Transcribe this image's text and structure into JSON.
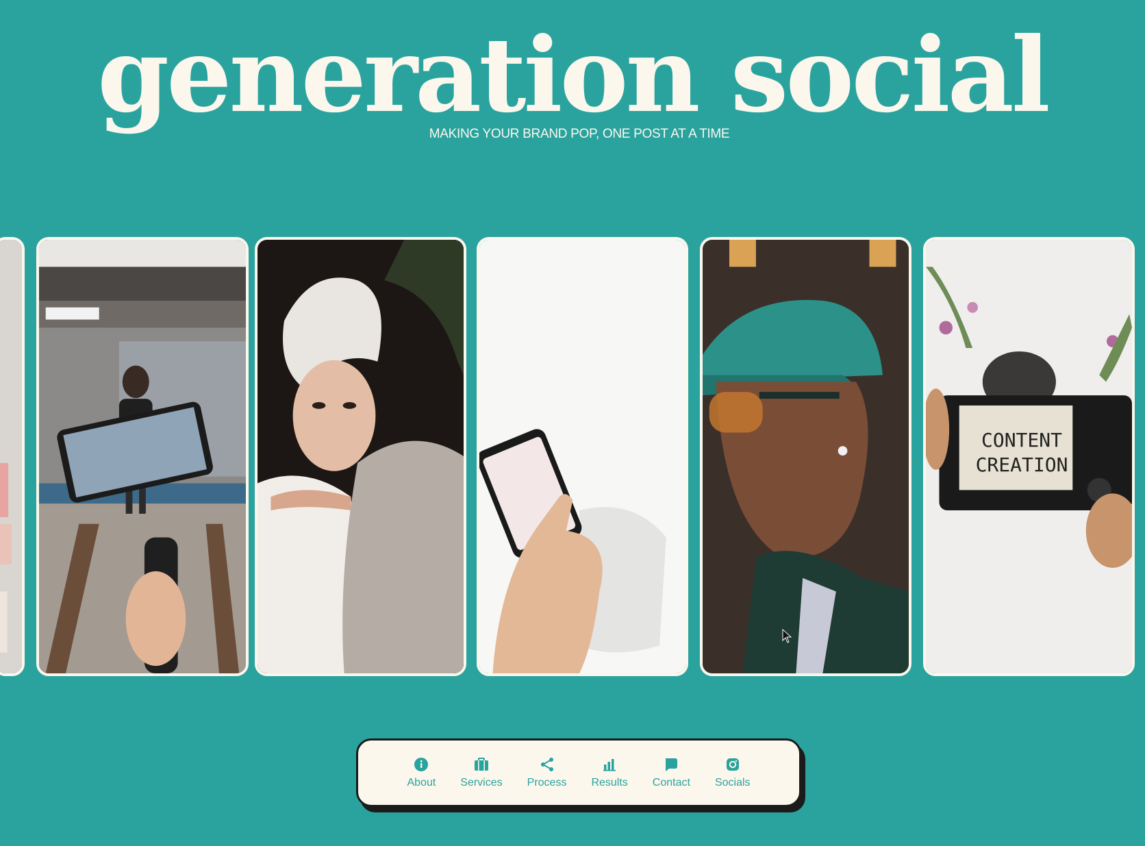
{
  "header": {
    "title": "generation social",
    "tagline": "MAKING YOUR BRAND POP, ONE POST AT A TIME"
  },
  "carousel": {
    "cards": [
      {
        "name": "card-partial-left",
        "caption": ""
      },
      {
        "name": "card-gimbal-subway",
        "caption": ""
      },
      {
        "name": "card-towel-woman",
        "caption": ""
      },
      {
        "name": "card-phone-tap",
        "caption": ""
      },
      {
        "name": "card-man-cap",
        "caption": ""
      },
      {
        "name": "card-content-creation",
        "caption": "CONTENT CREATION"
      }
    ],
    "content_creation_line1": "CONTENT",
    "content_creation_line2": "CREATION"
  },
  "nav": {
    "items": [
      {
        "label": "About",
        "icon": "info-icon"
      },
      {
        "label": "Services",
        "icon": "briefcase-icon"
      },
      {
        "label": "Process",
        "icon": "share-icon"
      },
      {
        "label": "Results",
        "icon": "bar-chart-icon"
      },
      {
        "label": "Contact",
        "icon": "chat-bubble-icon"
      },
      {
        "label": "Socials",
        "icon": "instagram-icon"
      }
    ]
  },
  "colors": {
    "background": "#2aa39f",
    "cream": "#fbf7ec",
    "accent": "#2aa39f",
    "dark": "#1b1b1b"
  }
}
